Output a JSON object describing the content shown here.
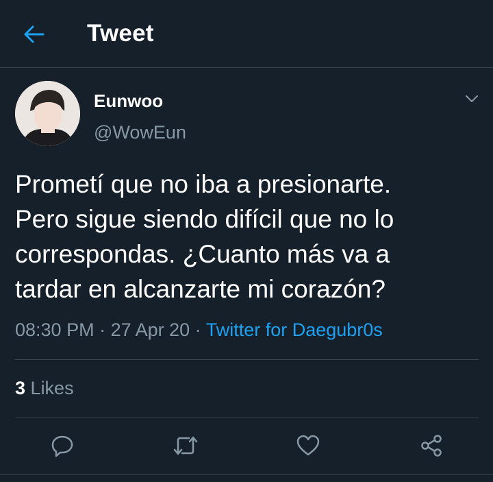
{
  "header": {
    "title": "Tweet",
    "back_icon": "arrow-left-icon"
  },
  "tweet": {
    "author_name": "Eunwoo",
    "author_handle": "@WowEun",
    "text": "Prometí que no iba a presionarte.\nPero sigue siendo difícil que no lo\ncorrespondas. ¿Cuanto más va a\ntardar en alcanzarte mi corazón?",
    "time": "08:30 PM",
    "separator": " · ",
    "date": "27 Apr 20",
    "source": "Twitter for Daegubr0s",
    "likes_count": "3",
    "likes_label": "Likes"
  },
  "actions": {
    "reply_icon": "reply-icon",
    "retweet_icon": "retweet-icon",
    "like_icon": "heart-icon",
    "share_icon": "share-icon"
  },
  "colors": {
    "background": "#15202b",
    "accent": "#1da1f2",
    "secondary_text": "#8899a6",
    "divider": "#38444d"
  }
}
